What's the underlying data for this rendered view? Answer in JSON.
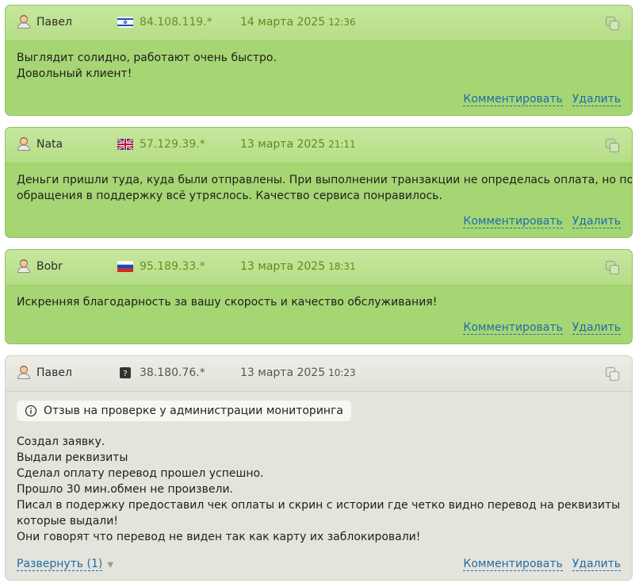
{
  "reviews": [
    {
      "author": "Павел",
      "flag": "israel",
      "ip": "84.108.119.*",
      "date": "14 марта 2025",
      "time": "12:36",
      "lines": [
        "Выглядит солидно, работают очень быстро.",
        "Довольный клиент!"
      ],
      "comment_label": "Комментировать",
      "delete_label": "Удалить"
    },
    {
      "author": "Nata",
      "flag": "uk",
      "ip": "57.129.39.*",
      "date": "13 марта 2025",
      "time": "21:11",
      "lines": [
        "Деньги пришли туда, куда были отправлены. При выполнении транзакции не определась оплата, но после",
        "обращения в поддержку всё утряслось. Качество сервиса понравилось."
      ],
      "comment_label": "Комментировать",
      "delete_label": "Удалить"
    },
    {
      "author": "Bobr",
      "flag": "russia",
      "ip": "95.189.33.*",
      "date": "13 марта 2025",
      "time": "18:31",
      "lines": [
        "Искренняя благодарность за вашу скорость и качество обслуживания!"
      ],
      "comment_label": "Комментировать",
      "delete_label": "Удалить"
    },
    {
      "author": "Павел",
      "flag": "unknown",
      "ip": "38.180.76.*",
      "date": "13 марта 2025",
      "time": "10:23",
      "moderation_note": "Отзыв на проверке у администрации мониторинга",
      "lines": [
        "Создал заявку.",
        "Выдали реквизиты",
        "Сделал оплату перевод прошел успешно.",
        "Прошло 30 мин.обмен не произвели.",
        "Писал в подержку предоставил чек оплаты и скрин с истории где четко видно перевод на реквизиты",
        "которые выдали!",
        "Они говорят что перевод не виден так как карту их заблокировали!"
      ],
      "expand_label": "Развернуть (1)",
      "comment_label": "Комментировать",
      "delete_label": "Удалить"
    }
  ],
  "colors": {
    "positive_bg": "#a6d673",
    "neutral_bg": "#e4e4dc",
    "link": "#1f6ca8"
  }
}
